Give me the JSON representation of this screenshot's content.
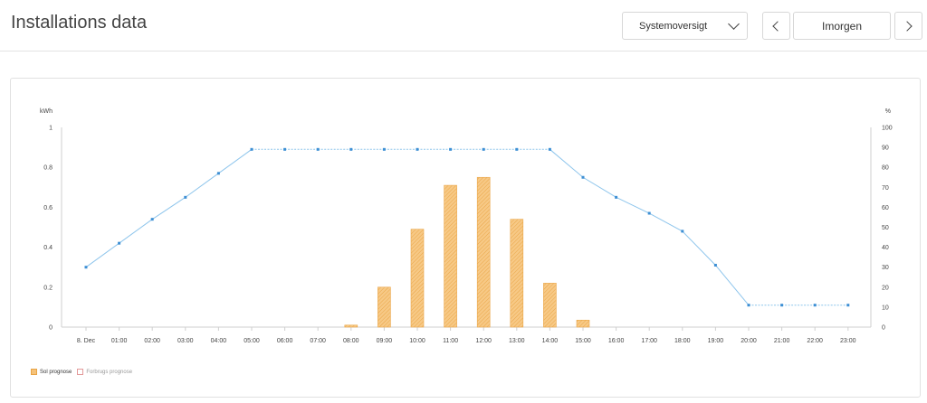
{
  "header": {
    "title": "Installations data",
    "view_select": "Systemoversigt",
    "date_label": "Imorgen"
  },
  "colors": {
    "bar_fill": "#f7c986",
    "bar_stroke": "#eaa648",
    "line": "#8ec5ec",
    "marker": "#3d8fd4",
    "axis_text": "#444444"
  },
  "icons": {
    "select_arrow": "chevron-down-icon",
    "prev": "chevron-left-icon",
    "next": "chevron-right-icon"
  },
  "legend": {
    "sol": "Sol prognose",
    "forbrug": "Forbrugs prognose"
  },
  "chart_data": {
    "type": "bar",
    "categories": [
      "8. Dec",
      "01:00",
      "02:00",
      "03:00",
      "04:00",
      "05:00",
      "06:00",
      "07:00",
      "08:00",
      "09:00",
      "10:00",
      "11:00",
      "12:00",
      "13:00",
      "14:00",
      "15:00",
      "16:00",
      "17:00",
      "18:00",
      "19:00",
      "20:00",
      "21:00",
      "22:00",
      "23:00"
    ],
    "y_left_label": "kWh",
    "y_left_ticks": [
      "0",
      "0.2",
      "0.4",
      "0.6",
      "0.8",
      "1"
    ],
    "ylim_left": [
      0,
      1
    ],
    "y_right_label": "%",
    "y_right_ticks": [
      "0",
      "10",
      "20",
      "30",
      "40",
      "50",
      "60",
      "70",
      "80",
      "90",
      "100"
    ],
    "ylim_right": [
      0,
      100
    ],
    "series": [
      {
        "name": "Sol prognose",
        "type": "bar",
        "axis": "left",
        "values": [
          0,
          0,
          0,
          0,
          0,
          0,
          0,
          0,
          0.01,
          0.2,
          0.49,
          0.71,
          0.75,
          0.54,
          0.22,
          0.035,
          0,
          0,
          0,
          0,
          0,
          0,
          0,
          0
        ]
      },
      {
        "name": "Forbrugs prognose",
        "type": "bar",
        "axis": "left",
        "values": [
          0,
          0,
          0,
          0,
          0,
          0,
          0,
          0,
          0,
          0,
          0,
          0,
          0,
          0,
          0,
          0,
          0,
          0,
          0,
          0,
          0,
          0,
          0,
          0
        ]
      },
      {
        "type": "line",
        "axis": "right",
        "values": [
          30,
          42,
          54,
          65,
          77,
          89,
          89,
          89,
          89,
          89,
          89,
          89,
          89,
          89,
          89,
          75,
          65,
          57,
          48,
          31,
          11,
          11,
          11,
          11
        ]
      }
    ],
    "grid": false,
    "legend_position": "bottom-left"
  }
}
